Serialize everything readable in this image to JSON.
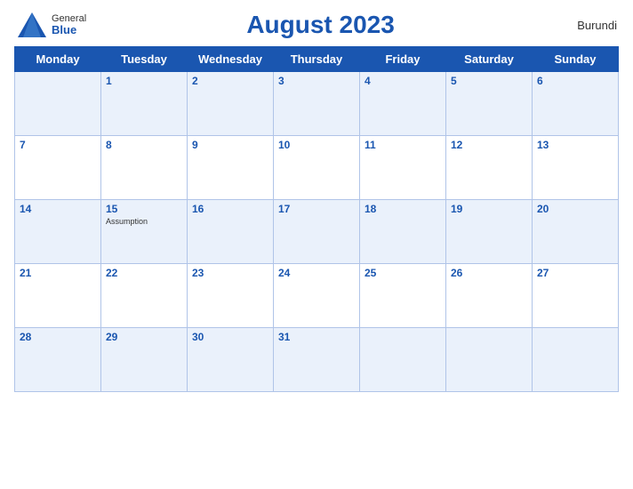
{
  "header": {
    "logo_general": "General",
    "logo_blue": "Blue",
    "title": "August 2023",
    "country": "Burundi"
  },
  "days_of_week": [
    "Monday",
    "Tuesday",
    "Wednesday",
    "Thursday",
    "Friday",
    "Saturday",
    "Sunday"
  ],
  "weeks": [
    [
      {
        "day": "",
        "empty": true
      },
      {
        "day": "1"
      },
      {
        "day": "2"
      },
      {
        "day": "3"
      },
      {
        "day": "4"
      },
      {
        "day": "5"
      },
      {
        "day": "6"
      }
    ],
    [
      {
        "day": "7"
      },
      {
        "day": "8"
      },
      {
        "day": "9"
      },
      {
        "day": "10"
      },
      {
        "day": "11"
      },
      {
        "day": "12"
      },
      {
        "day": "13"
      }
    ],
    [
      {
        "day": "14"
      },
      {
        "day": "15",
        "holiday": "Assumption"
      },
      {
        "day": "16"
      },
      {
        "day": "17"
      },
      {
        "day": "18"
      },
      {
        "day": "19"
      },
      {
        "day": "20"
      }
    ],
    [
      {
        "day": "21"
      },
      {
        "day": "22"
      },
      {
        "day": "23"
      },
      {
        "day": "24"
      },
      {
        "day": "25"
      },
      {
        "day": "26"
      },
      {
        "day": "27"
      }
    ],
    [
      {
        "day": "28"
      },
      {
        "day": "29"
      },
      {
        "day": "30"
      },
      {
        "day": "31"
      },
      {
        "day": "",
        "empty": true
      },
      {
        "day": "",
        "empty": true
      },
      {
        "day": "",
        "empty": true
      }
    ]
  ]
}
